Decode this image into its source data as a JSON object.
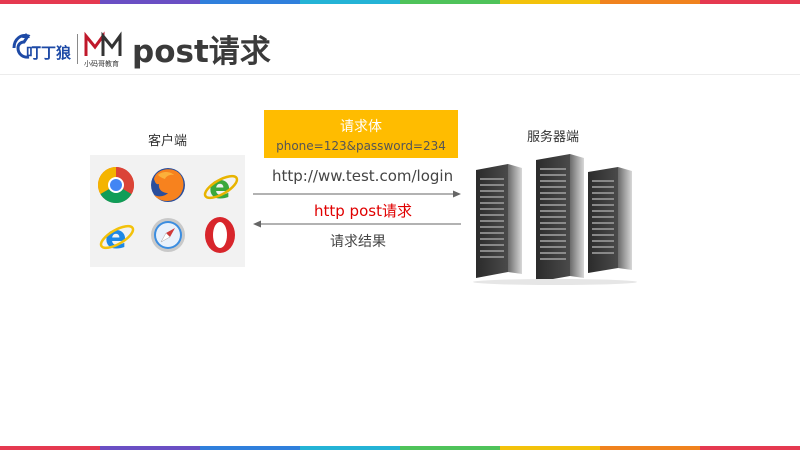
{
  "header": {
    "title": "post请求",
    "logo_left_icon": "dingding-logo-icon",
    "logo_right_icon": "xiaomage-logo-icon",
    "logo_right_caption": "小码哥教育"
  },
  "stripe_colors": [
    "#e53950",
    "#6a4fc4",
    "#2f7fdc",
    "#24b3d6",
    "#4fc35a",
    "#f3c20b",
    "#f0821e",
    "#e53950"
  ],
  "diagram": {
    "client_label": "客户端",
    "server_label": "服务器端",
    "request_body": {
      "title": "请求体",
      "content": "phone=123&password=234",
      "bg_color": "#ffbc00"
    },
    "url_text": "http://ww.test.com/login",
    "method_text": "http post请求",
    "method_color": "#e00000",
    "response_text": "请求结果",
    "browsers": [
      "chrome-icon",
      "firefox-icon",
      "ie-green-icon",
      "ie-icon",
      "safari-icon",
      "opera-icon"
    ]
  }
}
